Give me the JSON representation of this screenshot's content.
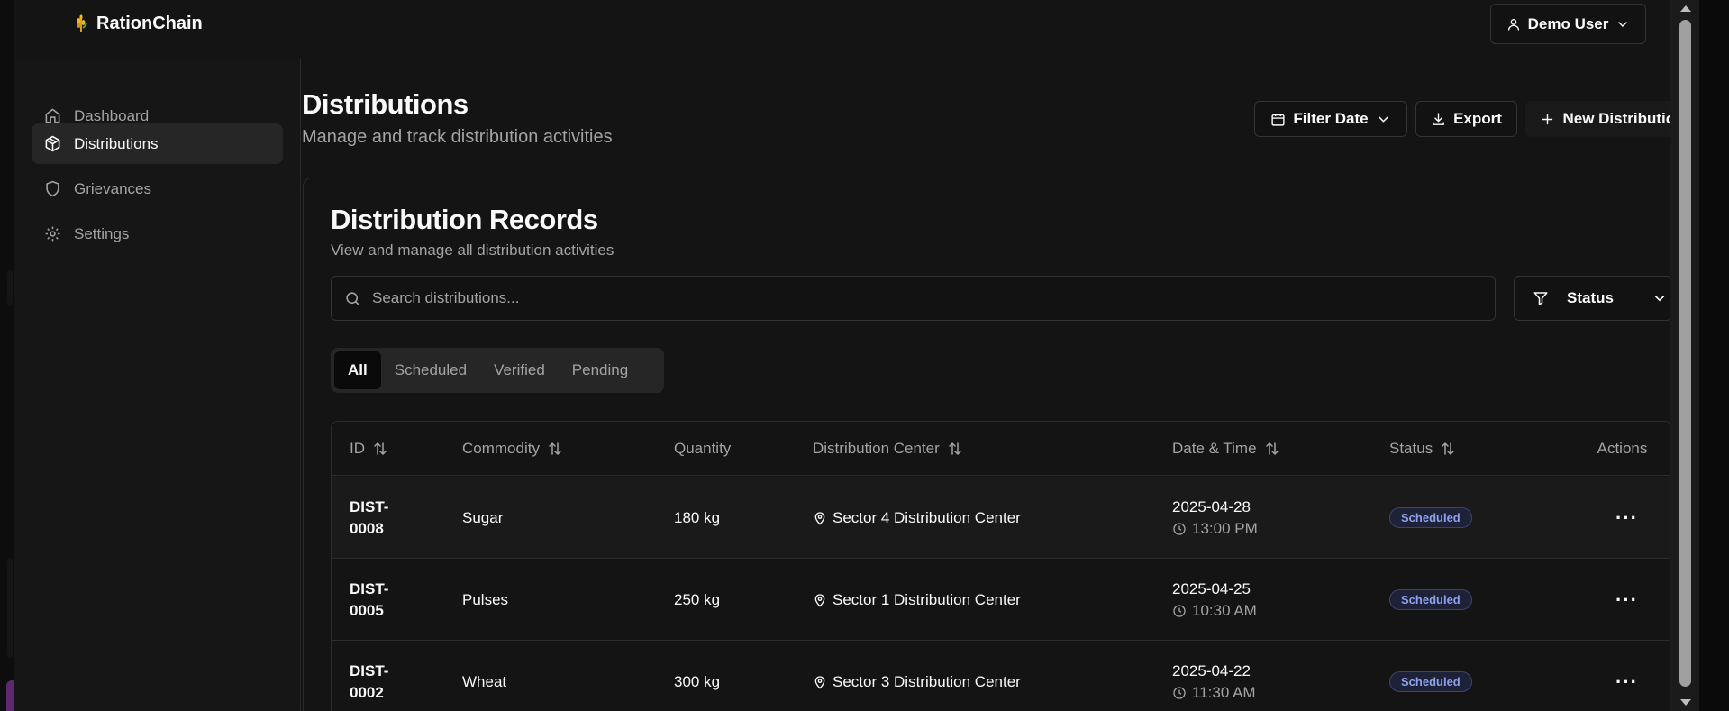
{
  "app": {
    "name": "RationChain"
  },
  "user_menu": {
    "label": "Demo User"
  },
  "sidebar": {
    "items": [
      {
        "label": "Dashboard",
        "icon": "home-icon",
        "active": false
      },
      {
        "label": "Distributions",
        "icon": "package-icon",
        "active": true
      },
      {
        "label": "Grievances",
        "icon": "shield-icon",
        "active": false
      },
      {
        "label": "Settings",
        "icon": "gear-icon",
        "active": false
      }
    ]
  },
  "page": {
    "title": "Distributions",
    "subtitle": "Manage and track distribution activities",
    "actions": {
      "filter_date": "Filter Date",
      "export": "Export",
      "new_distribution": "New Distribution"
    }
  },
  "card": {
    "title": "Distribution Records",
    "subtitle": "View and manage all distribution activities",
    "search_placeholder": "Search distributions...",
    "status_filter": "Status",
    "tabs": [
      "All",
      "Scheduled",
      "Verified",
      "Pending"
    ],
    "active_tab": "All"
  },
  "table": {
    "columns": [
      "ID",
      "Commodity",
      "Quantity",
      "Distribution Center",
      "Date & Time",
      "Status",
      "Actions"
    ],
    "rows": [
      {
        "id_a": "DIST-",
        "id_b": "0008",
        "commodity": "Sugar",
        "quantity": "180 kg",
        "center": "Sector 4 Distribution Center",
        "date": "2025-04-28",
        "time": "13:00 PM",
        "status": "Scheduled"
      },
      {
        "id_a": "DIST-",
        "id_b": "0005",
        "commodity": "Pulses",
        "quantity": "250 kg",
        "center": "Sector 1 Distribution Center",
        "date": "2025-04-25",
        "time": "10:30 AM",
        "status": "Scheduled"
      },
      {
        "id_a": "DIST-",
        "id_b": "0002",
        "commodity": "Wheat",
        "quantity": "300 kg",
        "center": "Sector 3 Distribution Center",
        "date": "2025-04-22",
        "time": "11:30 AM",
        "status": "Scheduled"
      }
    ]
  },
  "colors": {
    "background": "#141414",
    "sidebar_active": "#262626",
    "muted_text": "#a3a3a3",
    "badge_text": "#8ea0f0",
    "badge_bg": "#1e2238"
  }
}
